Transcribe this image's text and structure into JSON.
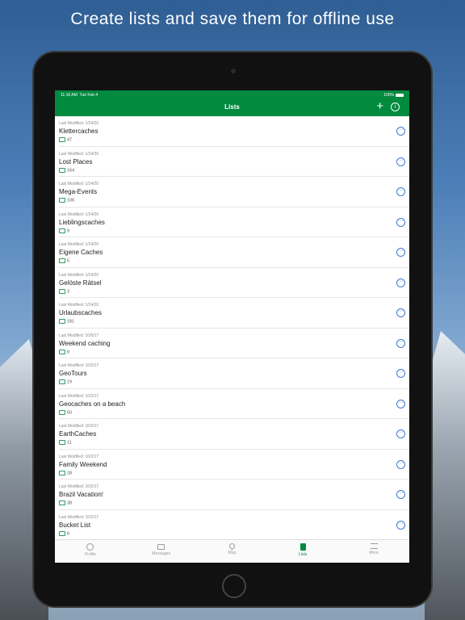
{
  "headline": "Create lists and save them for offline use",
  "status": {
    "time": "11:16 AM",
    "date": "Tue Feb 4",
    "battery": "100%"
  },
  "navbar": {
    "title": "Lists",
    "add_icon": "plus-icon",
    "info_icon": "info-icon"
  },
  "lists": [
    {
      "modified": "Last Modified: 1/24/20",
      "name": "Klettercaches",
      "count": "47"
    },
    {
      "modified": "Last Modified: 1/24/20",
      "name": "Lost Places",
      "count": "164"
    },
    {
      "modified": "Last Modified: 1/24/20",
      "name": "Mega-Events",
      "count": "106"
    },
    {
      "modified": "Last Modified: 1/24/20",
      "name": "Lieblingscaches",
      "count": "9"
    },
    {
      "modified": "Last Modified: 1/24/20",
      "name": "Eigene Caches",
      "count": "5"
    },
    {
      "modified": "Last Modified: 1/24/20",
      "name": "Gelöste Rätsel",
      "count": "3"
    },
    {
      "modified": "Last Modified: 1/24/20",
      "name": "Urlaubscaches",
      "count": "181"
    },
    {
      "modified": "Last Modified: 10/5/17",
      "name": "Weekend caching",
      "count": "8"
    },
    {
      "modified": "Last Modified: 10/2/17",
      "name": "GeoTours",
      "count": "19"
    },
    {
      "modified": "Last Modified: 10/2/17",
      "name": "Geocaches on a beach",
      "count": "50"
    },
    {
      "modified": "Last Modified: 10/2/17",
      "name": "EarthCaches",
      "count": "11"
    },
    {
      "modified": "Last Modified: 10/2/17",
      "name": "Family Weekend",
      "count": "28"
    },
    {
      "modified": "Last Modified: 10/2/17",
      "name": "Brazil Vacation!",
      "count": "38"
    },
    {
      "modified": "Last Modified: 10/2/17",
      "name": "Bucket List",
      "count": "6"
    }
  ],
  "tabs": [
    {
      "label": "Profile",
      "icon": "profile-icon"
    },
    {
      "label": "Messages",
      "icon": "envelope-icon"
    },
    {
      "label": "Map",
      "icon": "map-pin-icon"
    },
    {
      "label": "Lists",
      "icon": "list-icon",
      "active": true
    },
    {
      "label": "More",
      "icon": "menu-icon"
    }
  ],
  "colors": {
    "brand": "#028a3f",
    "accent": "#3f7ad6"
  }
}
